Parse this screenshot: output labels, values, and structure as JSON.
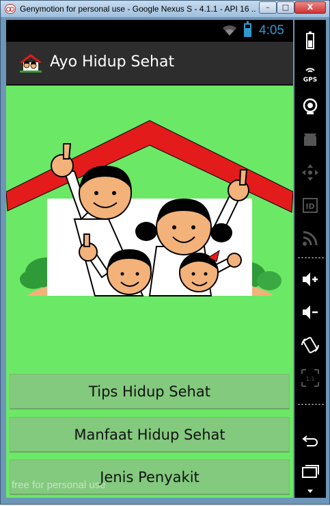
{
  "window": {
    "title": "Genymotion for personal use - Google Nexus S - 4.1.1 - API 16 ...",
    "minimize_label": "–",
    "maximize_label": "□",
    "close_label": "X"
  },
  "statusbar": {
    "time": "4:05"
  },
  "actionbar": {
    "title": "Ayo Hidup Sehat"
  },
  "menu": {
    "buttons": [
      {
        "label": "Tips Hidup Sehat"
      },
      {
        "label": "Manfaat Hidup Sehat"
      },
      {
        "label": "Jenis Penyakit"
      }
    ]
  },
  "watermark": "free for personal use",
  "sidebar": {
    "gps_label": "GPS",
    "id_label": "ID",
    "scale_label": "1:1"
  },
  "colors": {
    "content_bg": "#6be865",
    "button_bg": "#83c97e",
    "actionbar_bg": "#2d2d2d",
    "accent_blue": "#2e9ad0",
    "roof_red": "#e31b1b"
  }
}
